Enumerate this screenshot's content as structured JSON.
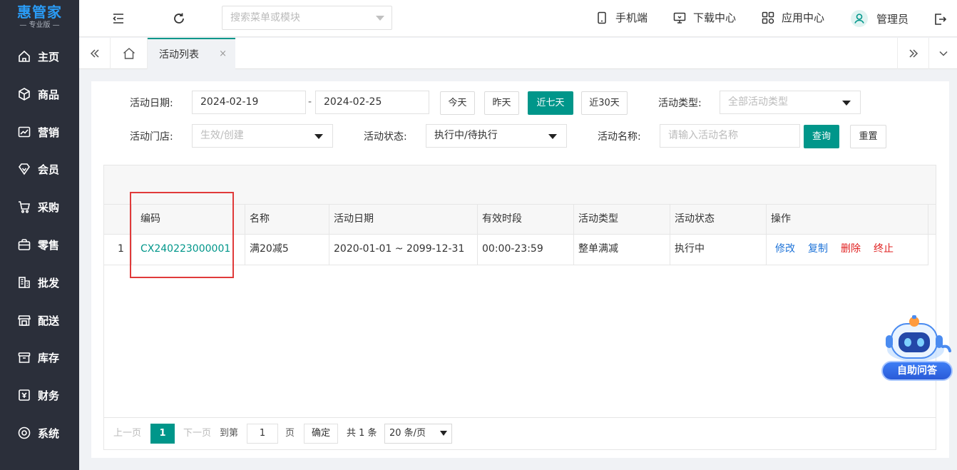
{
  "app": {
    "logo_main": "惠管家",
    "logo_sub": "— 专业版 —"
  },
  "sidebar": {
    "items": [
      {
        "label": "主页",
        "icon": "home-icon"
      },
      {
        "label": "商品",
        "icon": "box-icon"
      },
      {
        "label": "营销",
        "icon": "chart-icon"
      },
      {
        "label": "会员",
        "icon": "diamond-icon"
      },
      {
        "label": "采购",
        "icon": "cart-icon"
      },
      {
        "label": "零售",
        "icon": "bag-icon"
      },
      {
        "label": "批发",
        "icon": "building-icon"
      },
      {
        "label": "配送",
        "icon": "store-icon"
      },
      {
        "label": "库存",
        "icon": "archive-icon"
      },
      {
        "label": "财务",
        "icon": "finance-icon"
      },
      {
        "label": "系统",
        "icon": "settings-icon"
      }
    ]
  },
  "header": {
    "search_placeholder": "搜索菜单或模块",
    "mobile_label": "手机端",
    "download_label": "下载中心",
    "apps_label": "应用中心",
    "user_label": "管理员"
  },
  "tabs": {
    "active_label": "活动列表",
    "close_glyph": "×"
  },
  "filters": {
    "date_label": "活动日期:",
    "date_start": "2024-02-19",
    "date_sep": "-",
    "date_end": "2024-02-25",
    "today_label": "今天",
    "yesterday_label": "昨天",
    "last7_label": "近七天",
    "last30_label": "近30天",
    "type_label": "活动类型:",
    "type_placeholder": "全部活动类型",
    "store_label": "活动门店:",
    "store_placeholder": "生效/创建",
    "status_label": "活动状态:",
    "status_value": "执行中/待执行",
    "name_label": "活动名称:",
    "name_placeholder": "请输入活动名称",
    "query_label": "查询",
    "reset_label": "重置"
  },
  "table": {
    "headers": [
      "编码",
      "名称",
      "活动日期",
      "有效时段",
      "活动类型",
      "活动状态",
      "操作"
    ],
    "rows": [
      {
        "index": "1",
        "code": "CX240223000001",
        "name": "满20减5",
        "date_range": "2020-01-01 ~ 2099-12-31",
        "time_range": "00:00-23:59",
        "type": "整单满减",
        "status": "执行中",
        "actions": {
          "edit": "修改",
          "copy": "复制",
          "delete": "删除",
          "stop": "终止"
        }
      }
    ]
  },
  "pager": {
    "prev_label": "上一页",
    "current_page": "1",
    "next_label": "下一页",
    "goto_label": "到第",
    "goto_value": "1",
    "page_unit": "页",
    "confirm_label": "确定",
    "total_label": "共 1 条",
    "page_size": "20 条/页"
  },
  "assistant": {
    "label": "自助问答"
  },
  "colors": {
    "brand": "#00968a",
    "sidebar_bg": "#2b2f3a",
    "logo_blue": "#2a9bf5",
    "action_blue": "#1e73d8",
    "action_red": "#e02020",
    "highlight_red": "#e03a3a"
  }
}
